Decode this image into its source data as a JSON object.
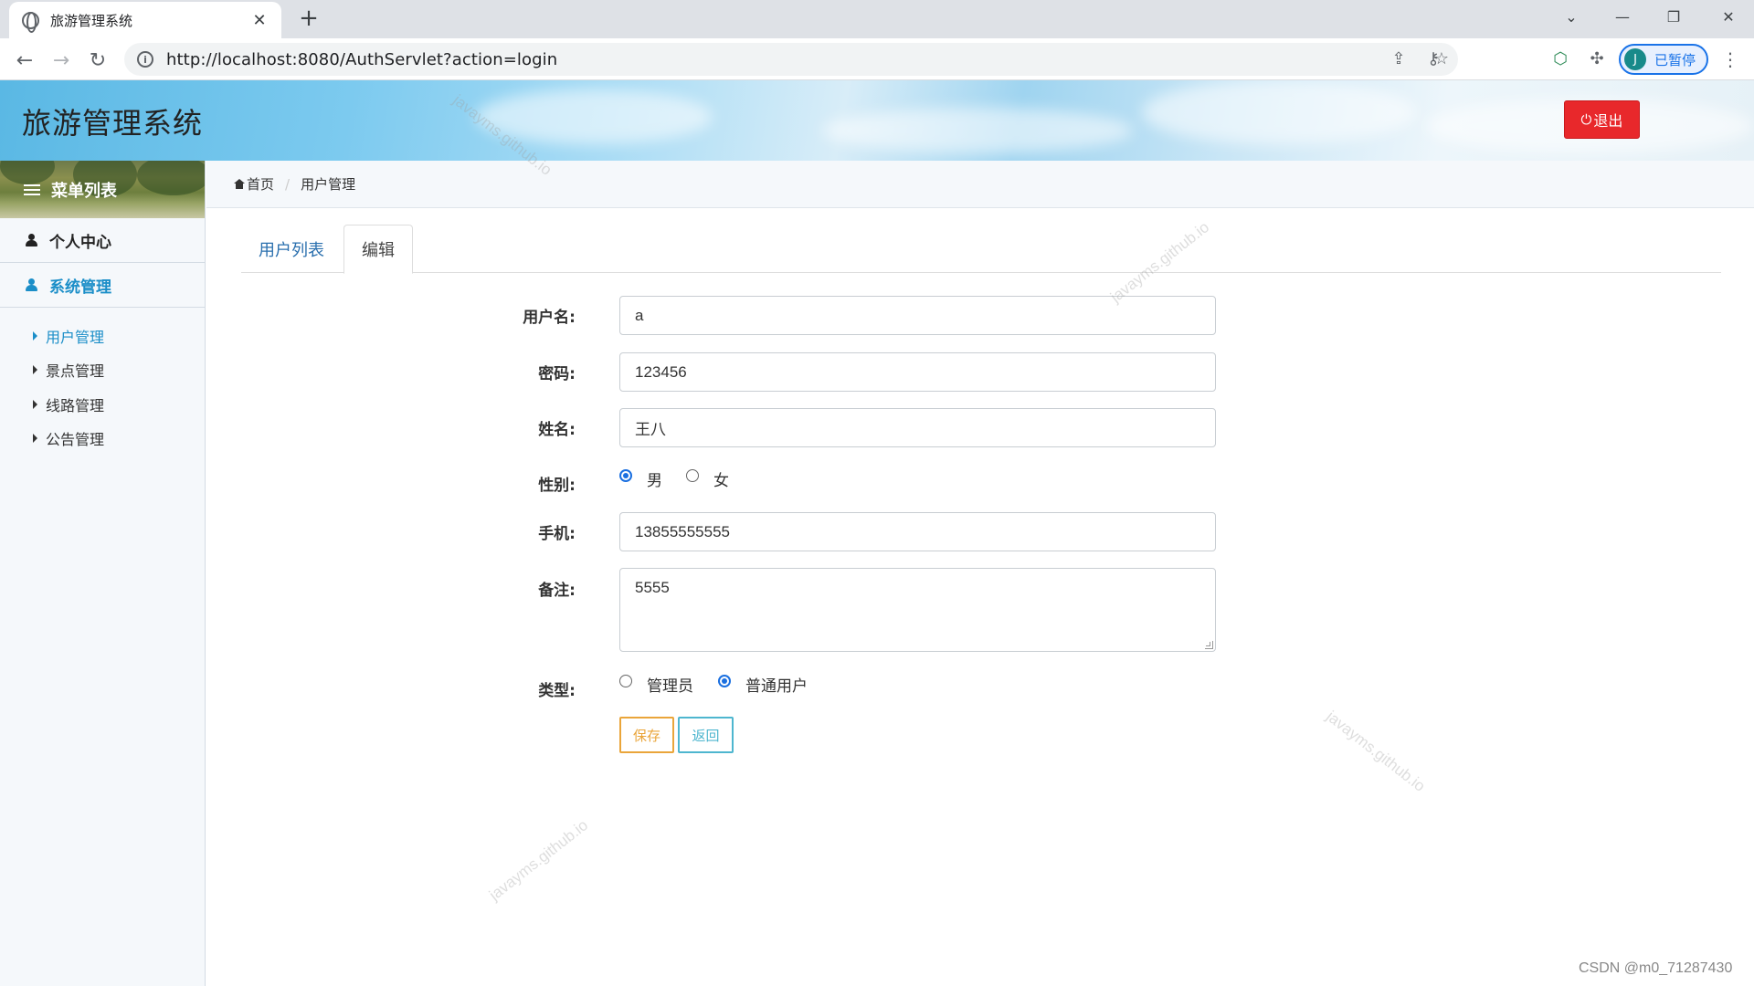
{
  "browser": {
    "tab_title": "旅游管理系统",
    "url": "http://localhost:8080/AuthServlet?action=login",
    "profile_initial": "J",
    "profile_label": "已暂停"
  },
  "header": {
    "title": "旅游管理系统",
    "logout_label": "退出"
  },
  "sidebar": {
    "heading": "菜单列表",
    "items": [
      {
        "label": "个人中心",
        "active": false
      },
      {
        "label": "系统管理",
        "active": true
      }
    ],
    "subitems": [
      {
        "label": "用户管理",
        "active": true
      },
      {
        "label": "景点管理",
        "active": false
      },
      {
        "label": "线路管理",
        "active": false
      },
      {
        "label": "公告管理",
        "active": false
      }
    ]
  },
  "breadcrumb": {
    "home": "首页",
    "current": "用户管理"
  },
  "tabs": [
    {
      "label": "用户列表",
      "active": false
    },
    {
      "label": "编辑",
      "active": true
    }
  ],
  "form": {
    "username": {
      "label": "用户名:",
      "value": "a"
    },
    "password": {
      "label": "密码:",
      "value": "123456"
    },
    "name": {
      "label": "姓名:",
      "value": "王八"
    },
    "gender": {
      "label": "性别:",
      "options": [
        "男",
        "女"
      ],
      "selected": "男"
    },
    "phone": {
      "label": "手机:",
      "value": "13855555555"
    },
    "remark": {
      "label": "备注:",
      "value": "5555"
    },
    "type": {
      "label": "类型:",
      "options": [
        "管理员",
        "普通用户"
      ],
      "selected": "普通用户"
    },
    "save_label": "保存",
    "back_label": "返回"
  },
  "watermark": "javayms.github.io",
  "credit": "CSDN @m0_71287430",
  "colors": {
    "accent": "#1b8ec8",
    "logout": "#e8282b",
    "save": "#eaa53a",
    "back": "#4eb6cf"
  }
}
